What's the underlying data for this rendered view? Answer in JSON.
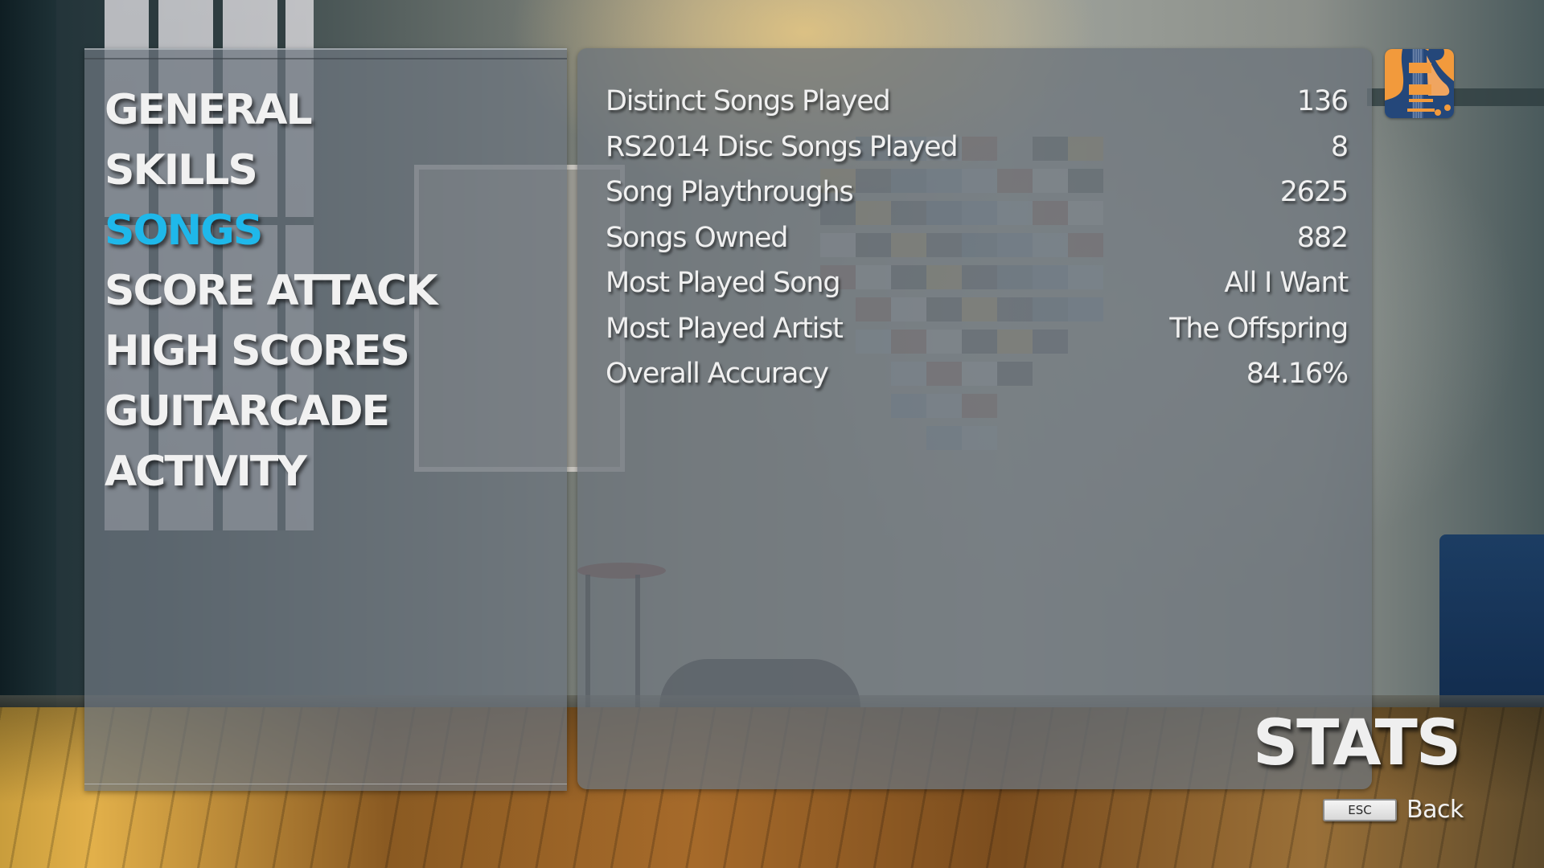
{
  "screen": {
    "title": "STATS"
  },
  "menu": {
    "items": [
      {
        "id": "general",
        "label": "GENERAL",
        "active": false
      },
      {
        "id": "skills",
        "label": "SKILLS",
        "active": false
      },
      {
        "id": "songs",
        "label": "SONGS",
        "active": true
      },
      {
        "id": "score-attack",
        "label": "SCORE ATTACK",
        "active": false
      },
      {
        "id": "high-scores",
        "label": "HIGH SCORES",
        "active": false
      },
      {
        "id": "guitarcade",
        "label": "GUITARCADE",
        "active": false
      },
      {
        "id": "activity",
        "label": "ACTIVITY",
        "active": false
      }
    ]
  },
  "stats": {
    "rows": [
      {
        "label": "Distinct Songs Played",
        "value": "136"
      },
      {
        "label": "RS2014 Disc Songs Played",
        "value": "8"
      },
      {
        "label": "Song Playthroughs",
        "value": "2625"
      },
      {
        "label": "Songs Owned",
        "value": "882"
      },
      {
        "label": "Most Played Song",
        "value": "All I Want"
      },
      {
        "label": "Most Played Artist",
        "value": "The Offspring"
      },
      {
        "label": "Overall Accuracy",
        "value": "84.16%"
      }
    ]
  },
  "profile": {
    "avatar_icon": "electric-guitar-icon"
  },
  "footer": {
    "back_key": "ESC",
    "back_label": "Back"
  },
  "colors": {
    "active_menu": "#1fb8ea",
    "text": "#f0f0f0",
    "avatar_orange": "#f29a3c",
    "avatar_blue": "#24477a"
  }
}
